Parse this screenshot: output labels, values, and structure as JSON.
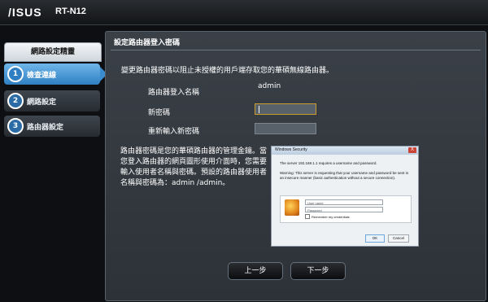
{
  "header": {
    "logo": "/ISUS",
    "model": "RT-N12"
  },
  "sidebar": {
    "title": "網路設定精靈",
    "steps": [
      {
        "num": "1",
        "label": "檢查連線"
      },
      {
        "num": "2",
        "label": "網路設定"
      },
      {
        "num": "3",
        "label": "路由器設定"
      }
    ]
  },
  "main": {
    "title": "設定路由器登入密碼",
    "description": "變更路由器密碼以阻止未授權的用戶端存取您的華碩無線路由器。",
    "form": {
      "username_label": "路由器登入名稱",
      "username_value": "admin",
      "password_label": "新密碼",
      "password_value": "",
      "confirm_label": "重新輸入新密碼",
      "confirm_value": ""
    },
    "note": "路由器密碼是您的華碩路由器的管理金鑰。當您登入路由器的網頁圖形使用介面時，您需要輸入使用者名稱與密碼。預設的路由器使用者名稱與密碼為：admin /admin。",
    "dialog": {
      "title": "Windows Security",
      "close": "X",
      "server_text": "The server 192.168.1.1 requires a username and password.",
      "warning_text": "Warning: This server is requesting that your username and password be sent in an insecure manner (basic authentication without a secure connection).",
      "username_placeholder": "User name",
      "password_placeholder": "Password",
      "remember_label": "Remember my credentials",
      "ok_label": "OK",
      "cancel_label": "Cancel"
    },
    "buttons": {
      "prev": "上一步",
      "next": "下一步"
    }
  }
}
